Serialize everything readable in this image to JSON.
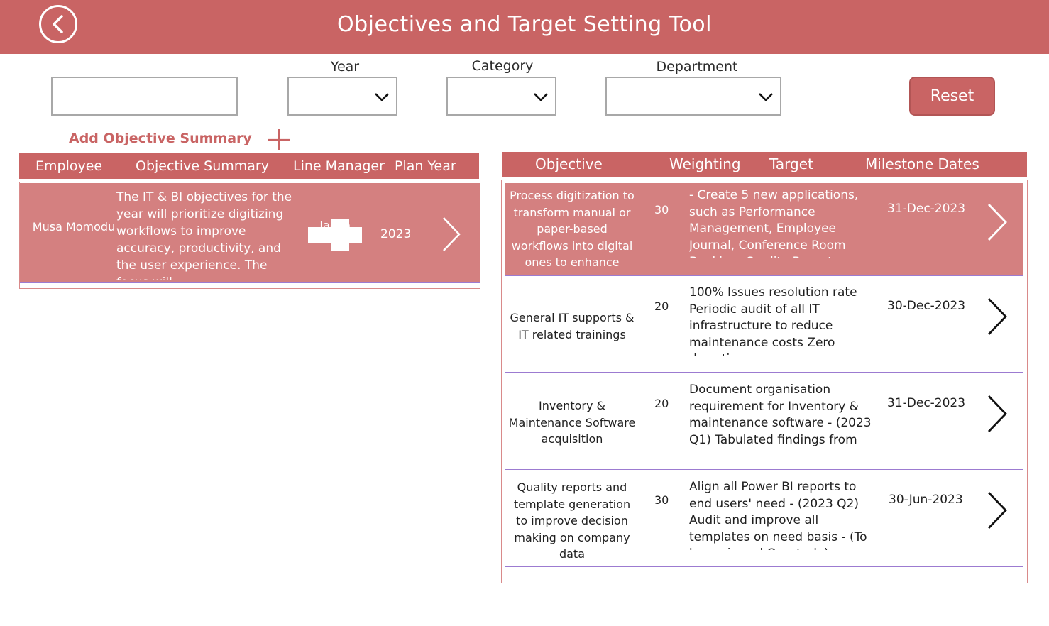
{
  "header": {
    "title": "Objectives and Target Setting Tool",
    "back_icon": "chevron-left-circle-icon"
  },
  "filters": {
    "search_value": "",
    "year_label": "Year",
    "year_value": "",
    "category_label": "Category",
    "category_value": "",
    "department_label": "Department",
    "department_value": "",
    "reset_label": "Reset"
  },
  "summary": {
    "add_label": "Add Objective Summary",
    "add_icon": "plus-icon",
    "columns": [
      "Employee",
      "Objective Summary",
      "Line Manager",
      "Plan Year"
    ],
    "rows": [
      {
        "employee": "Musa Momodu",
        "summary": "The IT & BI objectives for the year will prioritize digitizing workflows to improve accuracy, productivity, and the user experience. The focus will",
        "line_manager": "Jacob Bello",
        "plan_year": "2023"
      }
    ]
  },
  "objectives": {
    "columns": [
      "Objective",
      "Weighting",
      "Target",
      "Milestone Dates"
    ],
    "rows": [
      {
        "objective": "Process digitization to transform manual or paper-based workflows into digital ones to enhance",
        "weighting": "30",
        "target": "- Create 5 new applications, such as Performance Management, Employee Journal, Conference Room Booking, Quality Reports",
        "date": "31-Dec-2023"
      },
      {
        "objective": "General IT supports & IT related trainings",
        "weighting": "20",
        "target": "100% Issues resolution rate Periodic audit of all IT infrastructure to reduce maintenance costs Zero downtime",
        "date": "30-Dec-2023"
      },
      {
        "objective": "Inventory & Maintenance Software acquisition",
        "weighting": "20",
        "target": "Document organisation requirement for Inventory & maintenance software - (2023 Q1) Tabulated findings from vendor research",
        "date": "31-Dec-2023"
      },
      {
        "objective": "Quality reports and template generation to improve decision making on company data",
        "weighting": "30",
        "target": "Align all Power BI reports to end users' need - (2023 Q2) Audit and improve all templates on need basis - (To be reviewed Quarterly)",
        "date": "30-Jun-2023"
      }
    ]
  },
  "colors": {
    "accent": "#c96464",
    "row_selected": "#d48080",
    "separator": "#9c7bd1"
  }
}
